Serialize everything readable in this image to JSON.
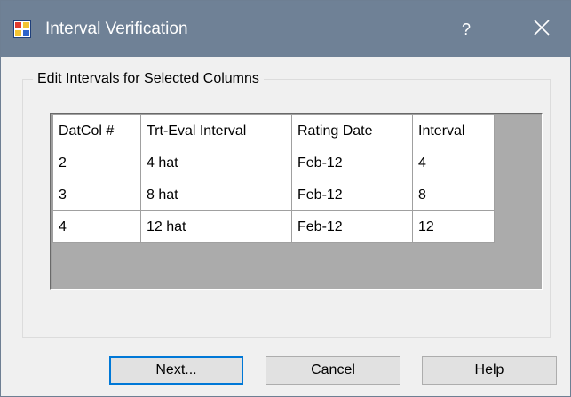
{
  "window": {
    "title": "Interval Verification",
    "help_symbol": "?",
    "close_icon": "close-icon",
    "app_icon": "grid-app-icon"
  },
  "group": {
    "label": "Edit Intervals for Selected Columns"
  },
  "grid": {
    "columns": [
      "DatCol #",
      "Trt-Eval Interval",
      "Rating Date",
      "Interval"
    ],
    "rows": [
      {
        "datcol": "2",
        "trt_eval_interval": "4 hat",
        "rating_date": "Feb-12",
        "interval": "4"
      },
      {
        "datcol": "3",
        "trt_eval_interval": "8 hat",
        "rating_date": "Feb-12",
        "interval": "8"
      },
      {
        "datcol": "4",
        "trt_eval_interval": "12 hat",
        "rating_date": "Feb-12",
        "interval": "12"
      }
    ]
  },
  "buttons": {
    "next": "Next...",
    "cancel": "Cancel",
    "help": "Help"
  },
  "colors": {
    "titlebar": "#6f8196",
    "window_bg": "#f0f0f0",
    "grid_empty_bg": "#ababab",
    "default_button_border": "#0078d7"
  }
}
